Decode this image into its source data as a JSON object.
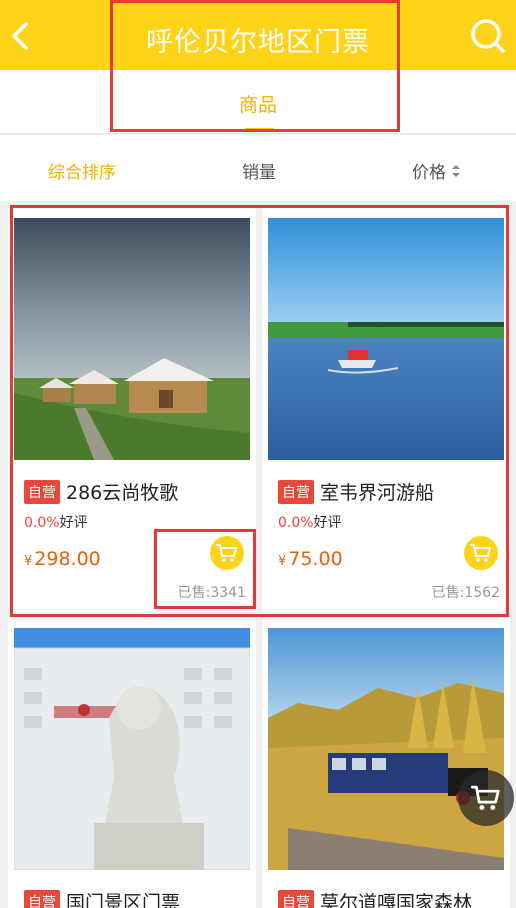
{
  "header": {
    "title": "呼伦贝尔地区门票",
    "back_icon": "chevron-left-icon",
    "search_icon": "search-icon",
    "background": "#ffd31a"
  },
  "tabs": [
    {
      "label": "商品",
      "active": true
    }
  ],
  "sort": {
    "items": [
      {
        "label": "综合排序",
        "active": true
      },
      {
        "label": "销量",
        "active": false
      },
      {
        "label": "价格",
        "active": false
      }
    ]
  },
  "products": [
    {
      "badge": "自营",
      "name": "286云尚牧歌",
      "rating_pct": "0.0%",
      "rating_label": "好评",
      "currency": "¥",
      "price": "298.00",
      "sold": "已售:3341"
    },
    {
      "badge": "自营",
      "name": "室韦界河游船",
      "rating_pct": "0.0%",
      "rating_label": "好评",
      "currency": "¥",
      "price": "75.00",
      "sold": "已售:1562"
    },
    {
      "badge": "自营",
      "name": "国门景区门票"
    },
    {
      "badge": "自营",
      "name": "莫尔道嘎国家森林"
    }
  ],
  "colors": {
    "accent": "#ffd31a",
    "price": "#e8600a",
    "badge": "#e8473a",
    "highlight": "#e33a3a"
  }
}
